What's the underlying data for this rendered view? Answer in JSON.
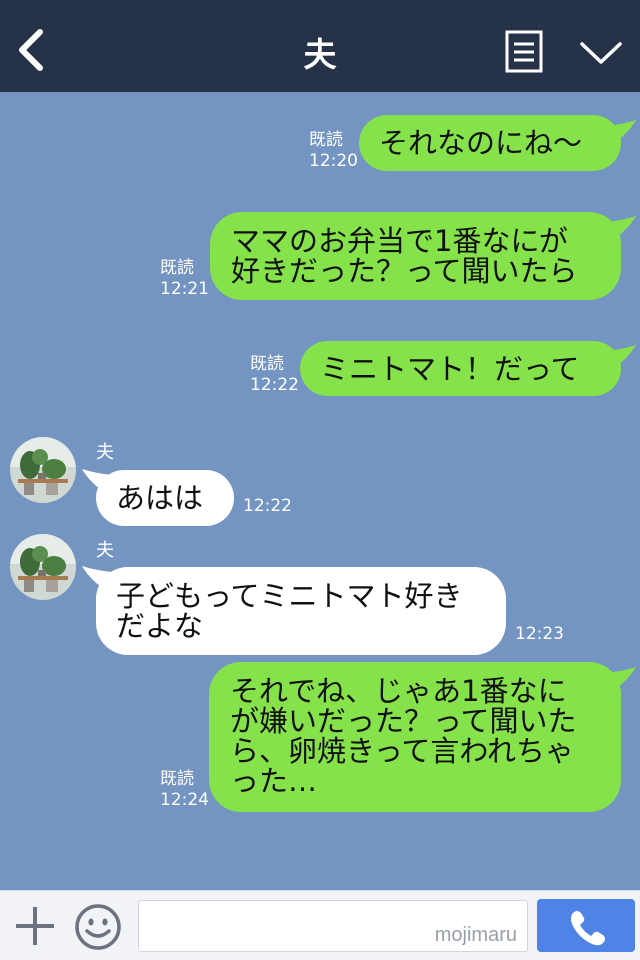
{
  "header": {
    "title": "夫",
    "back_icon": "chevron-left-icon",
    "menu_icon": "list-icon",
    "dropdown_icon": "chevron-down-icon",
    "background": "#263247"
  },
  "colors": {
    "chat_background": "#7494c1",
    "outgoing_bubble": "#86e24a",
    "incoming_bubble": "#ffffff",
    "call_button": "#4f83e6"
  },
  "messages": [
    {
      "direction": "out",
      "text": "それなのにね〜",
      "read_label": "既読",
      "time": "12:20"
    },
    {
      "direction": "out",
      "text": "ママのお弁当で1番なにが\n好きだった？って聞いたら",
      "read_label": "既読",
      "time": "12:21"
    },
    {
      "direction": "out",
      "text": "ミニトマト！だって",
      "read_label": "既読",
      "time": "12:22"
    },
    {
      "direction": "in",
      "sender": "夫",
      "text": "あはは",
      "time": "12:22"
    },
    {
      "direction": "in",
      "sender": "夫",
      "text": "子どもってミニトマト好き\nだよな",
      "time": "12:23"
    },
    {
      "direction": "out",
      "text": "それでね、じゃあ1番なに\nが嫌いだった？って聞いた\nら、卵焼きって言われちゃ\nった…",
      "read_label": "既読",
      "time": "12:24"
    }
  ],
  "input_bar": {
    "plus_icon": "plus-icon",
    "emoji_icon": "smiley-icon",
    "placeholder": "",
    "watermark": "mojimaru",
    "call_icon": "phone-icon"
  }
}
